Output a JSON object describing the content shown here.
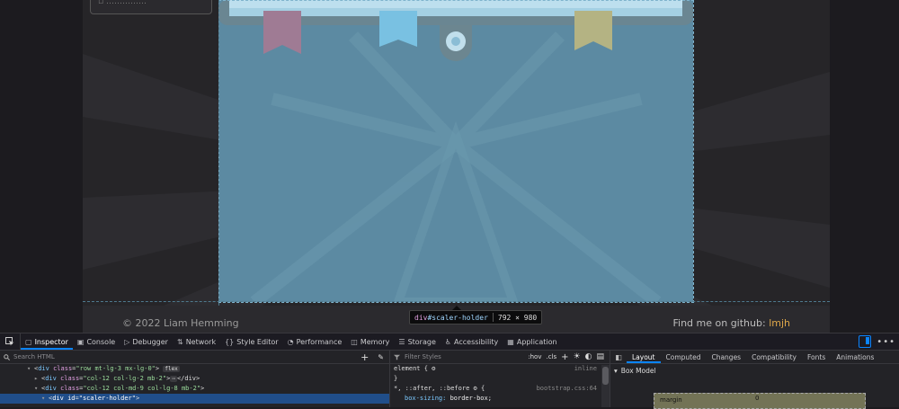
{
  "footer": {
    "copyright": "© 2022 Liam Hemming",
    "github_text": "Find me on github:",
    "github_link": "lmjh"
  },
  "tooltip": {
    "tag": "div",
    "id": "#scaler-holder",
    "size": "792 × 980"
  },
  "devtools": {
    "tabs": [
      {
        "label": "Inspector",
        "icon": "inspector-icon"
      },
      {
        "label": "Console",
        "icon": "console-icon"
      },
      {
        "label": "Debugger",
        "icon": "debugger-icon"
      },
      {
        "label": "Network",
        "icon": "network-icon"
      },
      {
        "label": "Style Editor",
        "icon": "braces-icon"
      },
      {
        "label": "Performance",
        "icon": "performance-icon"
      },
      {
        "label": "Memory",
        "icon": "memory-icon"
      },
      {
        "label": "Storage",
        "icon": "storage-icon"
      },
      {
        "label": "Accessibility",
        "icon": "accessibility-icon"
      },
      {
        "label": "Application",
        "icon": "grid-icon"
      }
    ],
    "active_tab": "Inspector",
    "html_search_placeholder": "Search HTML",
    "tree": {
      "row1": {
        "tag": "div",
        "attr": "class",
        "val": "\"row mt-lg-3 mx-lg-0\"",
        "badge": "flex"
      },
      "row2": {
        "tag": "div",
        "attr": "class",
        "val": "\"col-12 col-lg-2 mb-2\"",
        "badge": "⋯",
        "close": "</div>"
      },
      "row3": {
        "tag": "div",
        "attr": "class",
        "val": "\"col-12 col-md-9 col-lg-8 mb-2\""
      },
      "row4": {
        "tag": "div",
        "attr": "id",
        "val": "\"scaler-holder\""
      }
    },
    "rules": {
      "filter_placeholder": "Filter Styles",
      "hov": ":hov",
      "cls": ".cls",
      "element_selector": "element {",
      "element_src": "inline",
      "close_brace": "}",
      "universal_selector": "*, ::after, ::before",
      "universal_src": "bootstrap.css:64",
      "prop": "box-sizing:",
      "value": "border-box;"
    },
    "layout_tabs": [
      "Layout",
      "Computed",
      "Changes",
      "Compatibility",
      "Fonts",
      "Animations"
    ],
    "active_layout_tab": "Layout",
    "box_model_title": "Box Model",
    "margin_label": "margin",
    "margin_value": "0"
  }
}
